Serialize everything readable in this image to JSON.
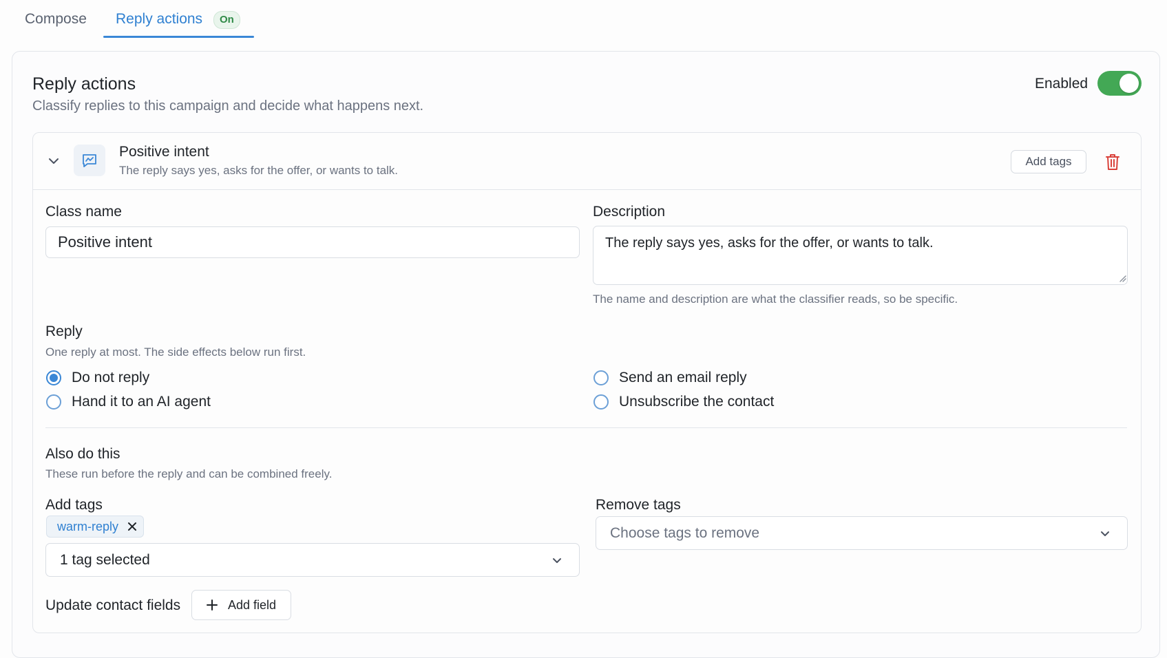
{
  "tabs": {
    "compose": "Compose",
    "reply_actions": "Reply actions",
    "reply_actions_badge": "On"
  },
  "card": {
    "title": "Reply actions",
    "subtitle": "Classify replies to this campaign and decide what happens next.",
    "enabled_label": "Enabled",
    "enabled": true
  },
  "class_panel": {
    "title": "Positive intent",
    "description": "The reply says yes, asks for the offer, or wants to talk.",
    "add_tags_button": "Add tags",
    "icons": {
      "collapse": "chevron-down-icon",
      "class": "chat-chart-icon",
      "delete": "trash-icon"
    }
  },
  "form": {
    "class_name_label": "Class name",
    "class_name_value": "Positive intent",
    "description_label": "Description",
    "description_value": "The reply says yes, asks for the offer, or wants to talk.",
    "description_hint": "The name and description are what the classifier reads, so be specific.",
    "reply_label": "Reply",
    "reply_hint": "One reply at most. The side effects below run first.",
    "reply_options": [
      {
        "label": "Do not reply",
        "checked": true
      },
      {
        "label": "Hand it to an AI agent",
        "checked": false
      },
      {
        "label": "Send an email reply",
        "checked": false
      },
      {
        "label": "Unsubscribe the contact",
        "checked": false
      }
    ],
    "also_label": "Also do this",
    "also_hint": "These run before the reply and can be combined freely.",
    "add_tags_label": "Add tags",
    "add_tags_chips": [
      "warm-reply"
    ],
    "add_tags_select": "1 tag selected",
    "remove_tags_label": "Remove tags",
    "remove_tags_placeholder": "Choose tags to remove",
    "update_fields_label": "Update contact fields",
    "add_field_button": "Add field"
  },
  "colors": {
    "accent": "#3a87d6",
    "toggle_on": "#43a855",
    "danger": "#d9413a"
  }
}
